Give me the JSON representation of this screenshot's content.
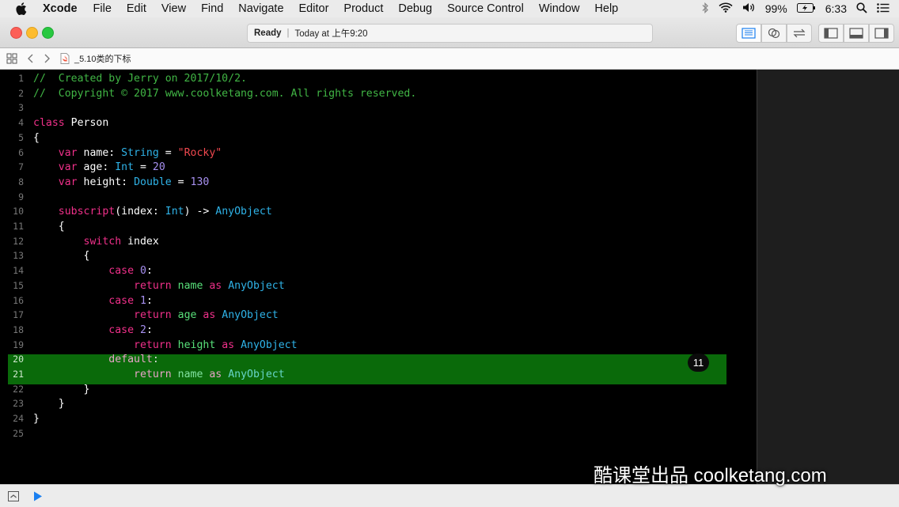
{
  "menubar": {
    "items": [
      "Xcode",
      "File",
      "Edit",
      "View",
      "Find",
      "Navigate",
      "Editor",
      "Product",
      "Debug",
      "Source Control",
      "Window",
      "Help"
    ],
    "battery": "99%",
    "time": "6:33"
  },
  "toolbar": {
    "status_ready": "Ready",
    "status_time": "Today at 上午9:20"
  },
  "jumpbar": {
    "file": "_5.10类的下标"
  },
  "editor": {
    "badge": "11",
    "lines": [
      {
        "n": "1",
        "t": [
          [
            "c-com",
            "//  Created by Jerry on 2017/10/2."
          ]
        ]
      },
      {
        "n": "2",
        "t": [
          [
            "c-com",
            "//  Copyright © 2017 www.coolketang.com. All rights reserved."
          ]
        ]
      },
      {
        "n": "3",
        "t": []
      },
      {
        "n": "4",
        "t": [
          [
            "c-kw",
            "class"
          ],
          [
            "c-plain",
            " Person"
          ]
        ]
      },
      {
        "n": "5",
        "t": [
          [
            "c-plain",
            "{"
          ]
        ]
      },
      {
        "n": "6",
        "t": [
          [
            "c-plain",
            "    "
          ],
          [
            "c-kw",
            "var"
          ],
          [
            "c-plain",
            " name: "
          ],
          [
            "c-type",
            "String"
          ],
          [
            "c-plain",
            " = "
          ],
          [
            "c-str",
            "\"Rocky\""
          ]
        ]
      },
      {
        "n": "7",
        "t": [
          [
            "c-plain",
            "    "
          ],
          [
            "c-kw",
            "var"
          ],
          [
            "c-plain",
            " age: "
          ],
          [
            "c-type",
            "Int"
          ],
          [
            "c-plain",
            " = "
          ],
          [
            "c-num",
            "20"
          ]
        ]
      },
      {
        "n": "8",
        "t": [
          [
            "c-plain",
            "    "
          ],
          [
            "c-kw",
            "var"
          ],
          [
            "c-plain",
            " height: "
          ],
          [
            "c-type",
            "Double"
          ],
          [
            "c-plain",
            " = "
          ],
          [
            "c-num",
            "130"
          ]
        ]
      },
      {
        "n": "9",
        "t": []
      },
      {
        "n": "10",
        "t": [
          [
            "c-plain",
            "    "
          ],
          [
            "c-kw",
            "subscript"
          ],
          [
            "c-plain",
            "(index: "
          ],
          [
            "c-type",
            "Int"
          ],
          [
            "c-plain",
            ") -> "
          ],
          [
            "c-type",
            "AnyObject"
          ]
        ]
      },
      {
        "n": "11",
        "t": [
          [
            "c-plain",
            "    {"
          ]
        ]
      },
      {
        "n": "12",
        "t": [
          [
            "c-plain",
            "        "
          ],
          [
            "c-kw",
            "switch"
          ],
          [
            "c-plain",
            " index"
          ]
        ]
      },
      {
        "n": "13",
        "t": [
          [
            "c-plain",
            "        {"
          ]
        ]
      },
      {
        "n": "14",
        "t": [
          [
            "c-plain",
            "            "
          ],
          [
            "c-kw",
            "case"
          ],
          [
            "c-plain",
            " "
          ],
          [
            "c-num",
            "0"
          ],
          [
            "c-plain",
            ":"
          ]
        ]
      },
      {
        "n": "15",
        "t": [
          [
            "c-plain",
            "                "
          ],
          [
            "c-kw",
            "return"
          ],
          [
            "c-plain",
            " "
          ],
          [
            "c-prop",
            "name"
          ],
          [
            "c-plain",
            " "
          ],
          [
            "c-kw",
            "as"
          ],
          [
            "c-plain",
            " "
          ],
          [
            "c-type",
            "AnyObject"
          ]
        ]
      },
      {
        "n": "16",
        "t": [
          [
            "c-plain",
            "            "
          ],
          [
            "c-kw",
            "case"
          ],
          [
            "c-plain",
            " "
          ],
          [
            "c-num",
            "1"
          ],
          [
            "c-plain",
            ":"
          ]
        ]
      },
      {
        "n": "17",
        "t": [
          [
            "c-plain",
            "                "
          ],
          [
            "c-kw",
            "return"
          ],
          [
            "c-plain",
            " "
          ],
          [
            "c-prop",
            "age"
          ],
          [
            "c-plain",
            " "
          ],
          [
            "c-kw",
            "as"
          ],
          [
            "c-plain",
            " "
          ],
          [
            "c-type",
            "AnyObject"
          ]
        ]
      },
      {
        "n": "18",
        "t": [
          [
            "c-plain",
            "            "
          ],
          [
            "c-kw",
            "case"
          ],
          [
            "c-plain",
            " "
          ],
          [
            "c-num",
            "2"
          ],
          [
            "c-plain",
            ":"
          ]
        ]
      },
      {
        "n": "19",
        "t": [
          [
            "c-plain",
            "                "
          ],
          [
            "c-kw",
            "return"
          ],
          [
            "c-plain",
            " "
          ],
          [
            "c-prop",
            "height"
          ],
          [
            "c-plain",
            " "
          ],
          [
            "c-kw",
            "as"
          ],
          [
            "c-plain",
            " "
          ],
          [
            "c-type",
            "AnyObject"
          ]
        ]
      },
      {
        "n": "20",
        "t": [
          [
            "c-plain",
            "            "
          ],
          [
            "c-hlkw",
            "default"
          ],
          [
            "c-hlplain",
            ":"
          ]
        ]
      },
      {
        "n": "21",
        "t": [
          [
            "c-plain",
            "                "
          ],
          [
            "c-hlkw",
            "return"
          ],
          [
            "c-hlplain",
            " "
          ],
          [
            "c-hlprop",
            "name"
          ],
          [
            "c-hlplain",
            " "
          ],
          [
            "c-hlkw",
            "as"
          ],
          [
            "c-hlplain",
            " "
          ],
          [
            "c-hltype",
            "AnyObject"
          ]
        ]
      },
      {
        "n": "22",
        "t": [
          [
            "c-plain",
            "        }"
          ]
        ]
      },
      {
        "n": "23",
        "t": [
          [
            "c-plain",
            "    }"
          ]
        ]
      },
      {
        "n": "24",
        "t": [
          [
            "c-plain",
            "}"
          ]
        ]
      },
      {
        "n": "25",
        "t": []
      }
    ]
  },
  "watermark": "酷课堂出品 coolketang.com"
}
